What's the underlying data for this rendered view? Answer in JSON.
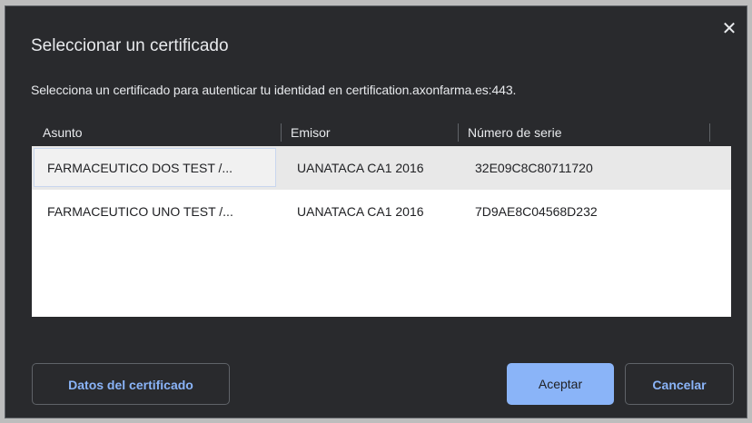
{
  "dialog": {
    "title": "Seleccionar un certificado",
    "close_glyph": "✕",
    "subtitle": "Selecciona un certificado para autenticar tu identidad en certification.axonfarma.es:443."
  },
  "table": {
    "columns": [
      "Asunto",
      "Emisor",
      "Número de serie"
    ],
    "rows": [
      {
        "asunto": "FARMACEUTICO DOS TEST /...",
        "emisor": "UANATACA CA1 2016",
        "serie": "32E09C8C80711720",
        "selected": true
      },
      {
        "asunto": "FARMACEUTICO UNO TEST /...",
        "emisor": "UANATACA CA1 2016",
        "serie": "7D9AE8C04568D232",
        "selected": false
      }
    ]
  },
  "buttons": {
    "details": "Datos del certificado",
    "accept": "Aceptar",
    "cancel": "Cancelar"
  },
  "colors": {
    "dialog_bg": "#292a2d",
    "accent": "#8ab4f8",
    "text": "#e8eaed",
    "table_bg": "#ffffff",
    "selected_row": "#e8e8e8"
  },
  "icons": {
    "close": "close-icon"
  }
}
